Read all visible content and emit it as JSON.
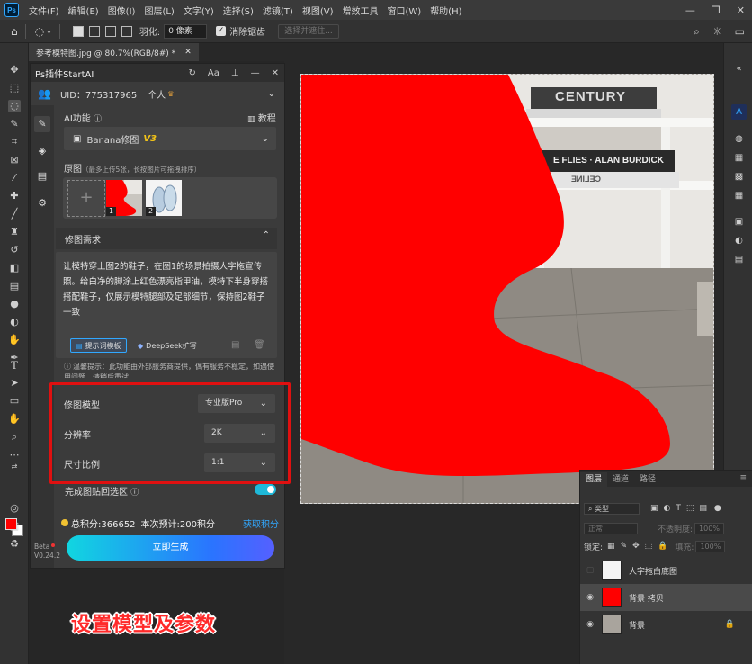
{
  "menubar": {
    "logo": "Ps",
    "items": [
      "文件(F)",
      "编辑(E)",
      "图像(I)",
      "图层(L)",
      "文字(Y)",
      "选择(S)",
      "滤镜(T)",
      "视图(V)",
      "增效工具",
      "窗口(W)",
      "帮助(H)"
    ],
    "controls": [
      "—",
      "❐",
      "✕"
    ]
  },
  "optionsbar": {
    "feather_label": "羽化:",
    "feather_value": "0 像素",
    "antialias_label": "消除锯齿",
    "select_subject": "选择并遮住..."
  },
  "document_tab": {
    "title": "参考模特图.jpg @ 80.7%(RGB/8#) *",
    "close": "✕"
  },
  "plugin": {
    "title": "Ps插件StartAI",
    "uid": "UID：775317965",
    "account_type": "个人",
    "ai_function_label": "AI功能",
    "tutorial": "教程",
    "mode": "Banana修图",
    "mode_version": "V3",
    "original_label": "原图",
    "original_hint": "（最多上传5张，长按图片可拖拽排序）",
    "thumb1_num": "1",
    "thumb2_num": "2",
    "requirement_label": "修图需求",
    "requirement_text": "让模特穿上图2的鞋子，在图1的场景拍摄人字拖宣传照。给白净的脚涂上红色漂亮指甲油，模特下半身穿搭搭配鞋子，仅展示模特腿部及足部细节，保持图2鞋子一致",
    "prompt_template": "提示词模板",
    "deepseek": "DeepSeek扩写",
    "tip": "温馨提示：此功能由外部服务商提供，偶有服务不稳定，如遇使用问题，请稍后重试",
    "model_label": "修图模型",
    "model_value": "专业版Pro",
    "resolution_label": "分辨率",
    "resolution_value": "2K",
    "ratio_label": "尺寸比例",
    "ratio_value": "1:1",
    "paste_back": "完成图贴回选区",
    "total_points": "总积分:366652",
    "estimate": "本次预计:200积分",
    "get_points": "获取积分",
    "generate": "立即生成",
    "beta": "Beta",
    "version": "V0.24.2"
  },
  "image_text": {
    "book1": "CENTURY",
    "book2": "E FLIES · ALAN BURDICK",
    "book3": "CELINE"
  },
  "layers_panel": {
    "tabs": [
      "图层",
      "通道",
      "路径"
    ],
    "filter": "类型",
    "blend": "正常",
    "opacity_label": "不透明度:",
    "opacity_value": "100%",
    "lock_label": "锁定:",
    "fill_label": "填充:",
    "fill_value": "100%",
    "layers": [
      "人字拖白底图",
      "背景 拷贝",
      "背景"
    ]
  },
  "caption": "设置模型及参数"
}
